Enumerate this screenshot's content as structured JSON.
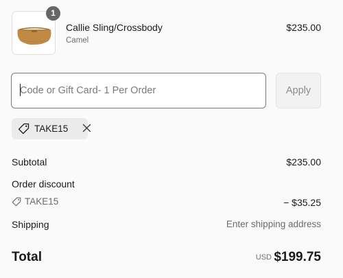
{
  "line_item": {
    "quantity": "1",
    "name": "Callie Sling/Crossbody",
    "variant": "Camel",
    "price": "$235.00",
    "image_icon": "camel-sling-bag-thumbnail"
  },
  "discount_form": {
    "placeholder": "Code or Gift Card- 1 Per Order",
    "value": "",
    "apply_label": "Apply"
  },
  "applied_discount": {
    "code": "TAKE15",
    "tag_icon": "tag-icon",
    "remove_icon": "close-icon"
  },
  "summary": {
    "subtotal_label": "Subtotal",
    "subtotal_value": "$235.00",
    "order_discount_label": "Order discount",
    "discount_code": "TAKE15",
    "discount_value": "− $35.25",
    "shipping_label": "Shipping",
    "shipping_value": "Enter shipping address",
    "total_label": "Total",
    "currency": "USD",
    "total_value": "$199.75"
  },
  "colors": {
    "background": "#fafafa",
    "text": "#1a1a1a",
    "muted": "#6b6b6b",
    "badge": "#666666",
    "chip": "#ebebeb",
    "input_border": "#7a7a7a",
    "product_camel": "#c08a45"
  }
}
